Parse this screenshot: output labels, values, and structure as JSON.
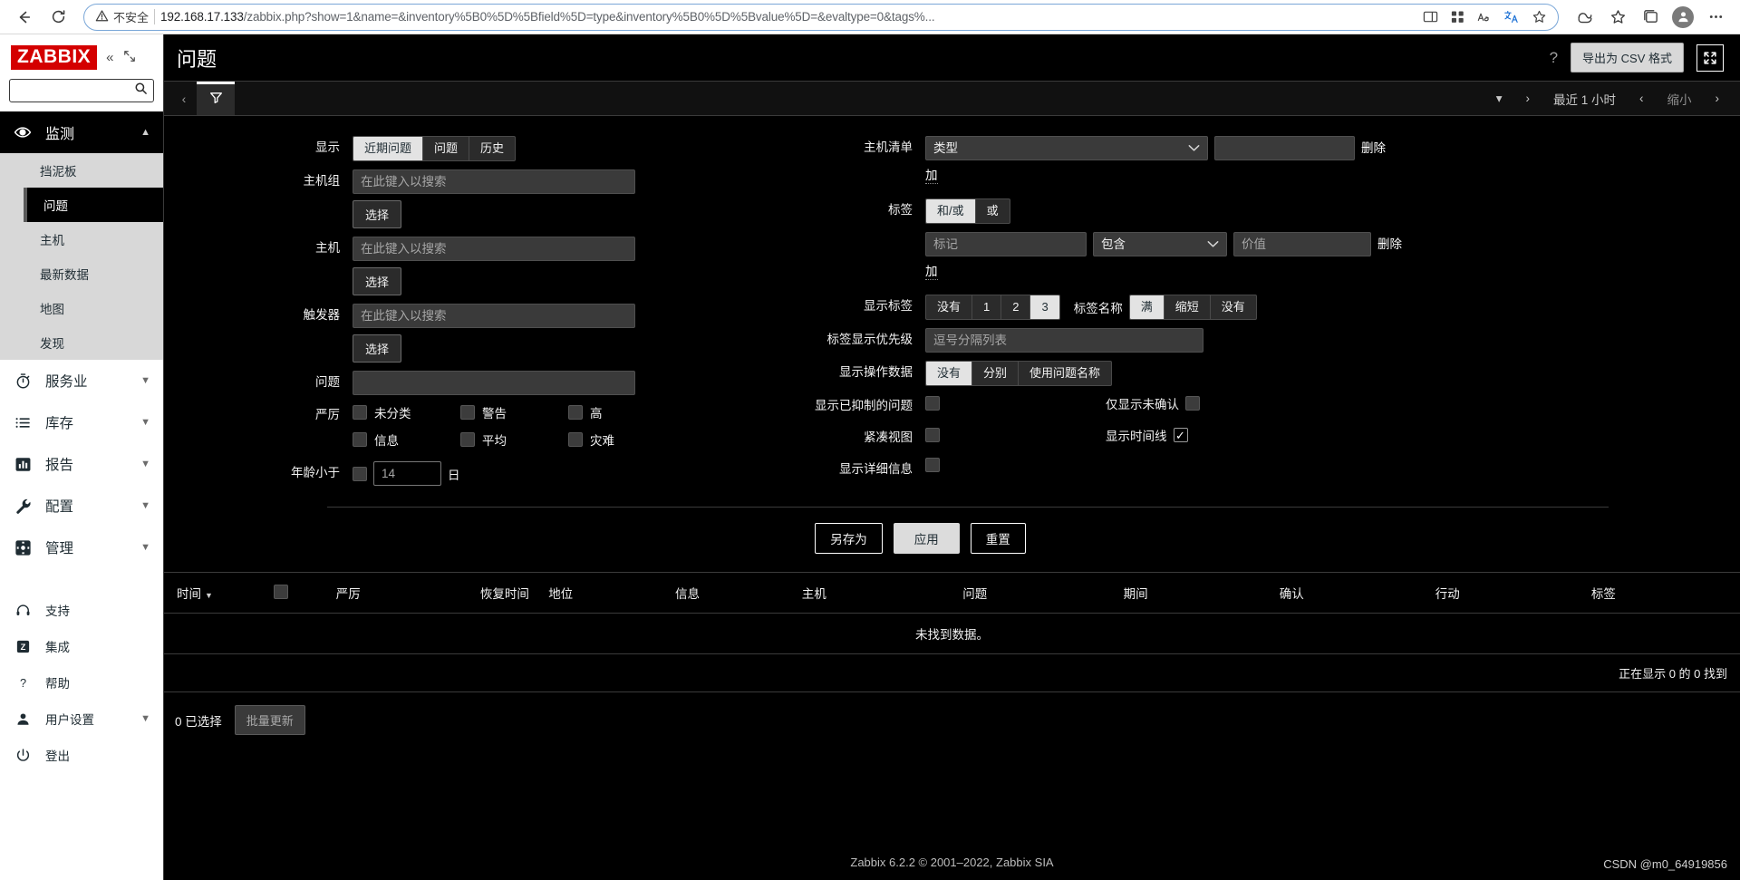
{
  "browser": {
    "security_label": "不安全",
    "url_host": "192.168.17.133",
    "url_path": "/zabbix.php?show=1&name=&inventory%5B0%5D%5Bfield%5D=type&inventory%5B0%5D%5Bvalue%5D=&evaltype=0&tags%...",
    "icons": {
      "back": "back-arrow-icon",
      "reload": "reload-icon",
      "warning": "warning-triangle-icon",
      "split_screen": "split-screen-icon",
      "collections": "collections-icon",
      "read_aloud": "read-aloud-icon",
      "translate": "translate-icon",
      "favorite": "favorite-star-icon",
      "copilot": "copilot-icon",
      "favorites_bar": "favorites-icon",
      "tabs": "tab-actions-icon",
      "profile": "profile-avatar-icon",
      "settings": "settings-ellipsis-icon"
    }
  },
  "sidebar": {
    "logo": "ZABBIX",
    "search_placeholder": "",
    "search_value": "",
    "monitoring": {
      "label": "监测",
      "icon": "eye-icon",
      "items": [
        {
          "label": "挡泥板",
          "active": false
        },
        {
          "label": "问题",
          "active": true
        },
        {
          "label": "主机",
          "active": false
        },
        {
          "label": "最新数据",
          "active": false
        },
        {
          "label": "地图",
          "active": false
        },
        {
          "label": "发现",
          "active": false
        }
      ]
    },
    "sections": [
      {
        "label": "服务业",
        "icon": "stopwatch-icon",
        "chevron": true
      },
      {
        "label": "库存",
        "icon": "list-icon",
        "chevron": true
      },
      {
        "label": "报告",
        "icon": "bar-chart-icon",
        "chevron": true
      },
      {
        "label": "配置",
        "icon": "wrench-icon",
        "chevron": true
      },
      {
        "label": "管理",
        "icon": "gear-icon",
        "chevron": true
      }
    ],
    "footer_items": [
      {
        "label": "支持",
        "icon": "headset-icon",
        "chevron": false
      },
      {
        "label": "集成",
        "icon": "zabbix-z-icon",
        "chevron": false
      },
      {
        "label": "帮助",
        "icon": "question-icon",
        "chevron": false
      },
      {
        "label": "用户设置",
        "icon": "user-icon",
        "chevron": true
      },
      {
        "label": "登出",
        "icon": "power-icon",
        "chevron": false
      }
    ]
  },
  "header": {
    "title": "问题",
    "help_icon": "question-mark-icon",
    "export_csv": "导出为 CSV 格式",
    "kiosk_icon": "fullscreen-icon"
  },
  "filter_tabs": {
    "prev_icon": "chevron-left-icon",
    "filter_icon": "funnel-icon",
    "time": {
      "chevron_down": "chevron-down-icon",
      "chevron_right": "chevron-right-icon",
      "range_label": "最近 1 小时",
      "zoom_prev": "chevron-left-icon",
      "zoom_out": "缩小",
      "zoom_next": "chevron-right-icon"
    }
  },
  "filter": {
    "show": {
      "label": "显示",
      "options": [
        "近期问题",
        "问题",
        "历史"
      ],
      "selected": "近期问题"
    },
    "host_group": {
      "label": "主机组",
      "placeholder": "在此键入以搜索",
      "value": "",
      "button": "选择"
    },
    "host": {
      "label": "主机",
      "placeholder": "在此键入以搜索",
      "value": "",
      "button": "选择"
    },
    "trigger": {
      "label": "触发器",
      "placeholder": "在此键入以搜索",
      "value": "",
      "button": "选择"
    },
    "problem": {
      "label": "问题",
      "placeholder": "",
      "value": ""
    },
    "severity": {
      "label": "严厉",
      "items": [
        {
          "label": "未分类",
          "checked": false
        },
        {
          "label": "信息",
          "checked": false
        },
        {
          "label": "警告",
          "checked": false
        },
        {
          "label": "平均",
          "checked": false
        },
        {
          "label": "高",
          "checked": false
        },
        {
          "label": "灾难",
          "checked": false
        }
      ]
    },
    "age": {
      "label": "年龄小于",
      "checked": false,
      "value": "",
      "placeholder": "14",
      "unit": "日"
    },
    "host_inventory": {
      "label": "主机清单",
      "select_value": "类型",
      "text_value": "",
      "remove": "删除",
      "add": "加"
    },
    "tags": {
      "label": "标签",
      "eval_options": [
        "和/或",
        "或"
      ],
      "eval_selected": "和/或",
      "tag_placeholder": "标记",
      "tag_value": "",
      "operator": "包含",
      "value_placeholder": "价值",
      "value_value": "",
      "remove": "删除",
      "add": "加"
    },
    "show_tags": {
      "label": "显示标签",
      "options": [
        "没有",
        "1",
        "2",
        "3"
      ],
      "selected": "3"
    },
    "tag_name": {
      "label": "标签名称",
      "options": [
        "满",
        "缩短",
        "没有"
      ],
      "selected": "满"
    },
    "tag_priority": {
      "label": "标签显示优先级",
      "placeholder": "逗号分隔列表",
      "value": ""
    },
    "show_op_data": {
      "label": "显示操作数据",
      "options": [
        "没有",
        "分别",
        "使用问题名称"
      ],
      "selected": "没有"
    },
    "show_suppressed": {
      "label": "显示已抑制的问题",
      "checked": false
    },
    "unacknowledged_only": {
      "label": "仅显示未确认",
      "checked": false
    },
    "compact_view": {
      "label": "紧凑视图",
      "checked": false
    },
    "show_timeline": {
      "label": "显示时间线",
      "checked": true
    },
    "show_details": {
      "label": "显示详细信息",
      "checked": false
    },
    "buttons": {
      "save_as": "另存为",
      "apply": "应用",
      "reset": "重置"
    }
  },
  "table": {
    "columns": [
      "时间",
      "",
      "严厉",
      "恢复时间",
      "地位",
      "信息",
      "主机",
      "问题",
      "期间",
      "确认",
      "行动",
      "标签"
    ],
    "sort_column": "时间",
    "sort_icon": "▼",
    "select_all_checked": false,
    "empty_message": "未找到数据。",
    "count_text": "正在显示 0 的 0 找到"
  },
  "bulk": {
    "selected_text": "0 已选择",
    "mass_update": "批量更新"
  },
  "footer": {
    "copyright": "Zabbix 6.2.2 © 2001–2022,  Zabbix SIA",
    "watermark": "CSDN @m0_64919856"
  }
}
